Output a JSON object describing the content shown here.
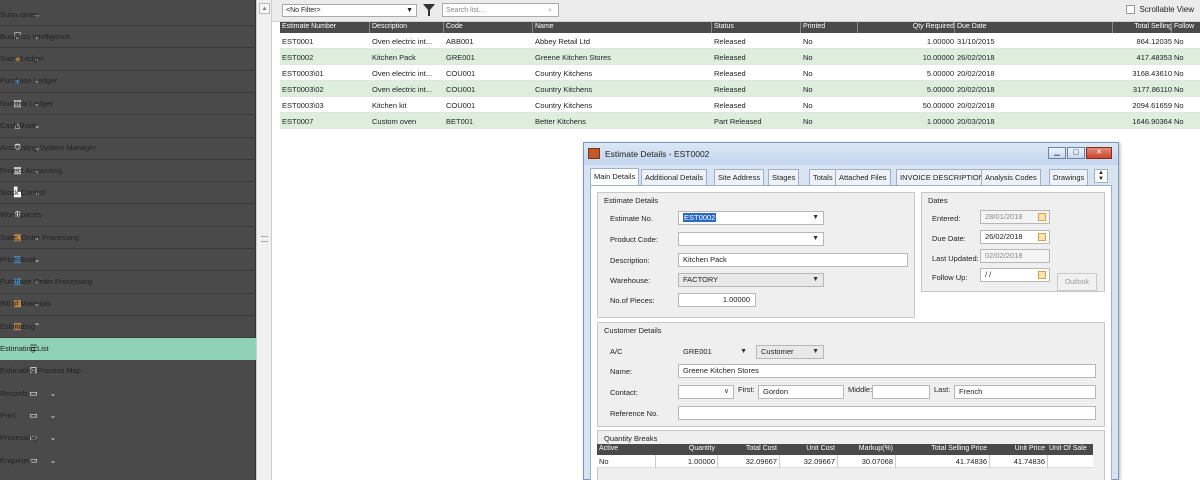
{
  "sidebar": {
    "items": [
      {
        "label": "Summaries",
        "icon": "pie-chart-icon",
        "color": "#5cb85c",
        "chevron": "down"
      },
      {
        "label": "Business Intelligence",
        "icon": "bi-icon",
        "color": "#ffffff",
        "chevron": "down"
      },
      {
        "label": "Sales Ledger",
        "icon": "person-icon",
        "color": "#f0a040",
        "chevron": "down"
      },
      {
        "label": "Purchase Ledger",
        "icon": "person-icon",
        "color": "#4aa0e0",
        "chevron": "down"
      },
      {
        "label": "Nominal Ledger",
        "icon": "book-icon",
        "color": "#ffffff",
        "chevron": "down"
      },
      {
        "label": "Cash Book",
        "icon": "bank-icon",
        "color": "#ffffff",
        "chevron": "down"
      },
      {
        "label": "Accounting System Manager",
        "icon": "settings-icon",
        "color": "#ffffff",
        "chevron": "down"
      },
      {
        "label": "Project Accounting",
        "icon": "document-icon",
        "color": "#ffffff",
        "chevron": "down"
      },
      {
        "label": "Stock Control",
        "icon": "boxes-icon",
        "color": "#ffffff",
        "chevron": "down"
      },
      {
        "label": "Workspaces",
        "icon": "globe-icon",
        "color": "#ffffff",
        "chevron": ""
      },
      {
        "label": "Sales Order Processing",
        "icon": "order-icon",
        "color": "#f0a040",
        "chevron": "down"
      },
      {
        "label": "Price Book",
        "icon": "price-book-icon",
        "color": "#4aa0e0",
        "chevron": "down"
      },
      {
        "label": "Purchase Order Processing",
        "icon": "order-icon",
        "color": "#4aa0e0",
        "chevron": "down"
      },
      {
        "label": "Bill of Materials",
        "icon": "bom-icon",
        "color": "#f0a040",
        "chevron": "down"
      },
      {
        "label": "Estimating",
        "icon": "estimating-icon",
        "color": "#f0a040",
        "chevron": "up"
      }
    ],
    "subitems": [
      {
        "label": "Estimating List",
        "icon": "list-icon",
        "active": true,
        "chevron": ""
      },
      {
        "label": "Estimating Process Map",
        "icon": "process-map-icon",
        "active": false,
        "chevron": ""
      },
      {
        "label": "Records",
        "icon": "folder-icon",
        "active": false,
        "chevron": "down"
      },
      {
        "label": "Print",
        "icon": "folder-icon",
        "active": false,
        "chevron": "down"
      },
      {
        "label": "Processing",
        "icon": "folder-icon",
        "active": false,
        "chevron": "down"
      },
      {
        "label": "Enquiries",
        "icon": "folder-icon",
        "active": false,
        "chevron": "down"
      }
    ]
  },
  "toolbar": {
    "filter_value": "<No Filter>",
    "search_placeholder": "Search list...",
    "scrollable_view_label": "Scrollable View"
  },
  "grid": {
    "headers": [
      "Estimate Number",
      "Description",
      "Code",
      "Name",
      "Status",
      "Printed",
      "Qty Required",
      "Due Date",
      "Total Selling",
      "Follow"
    ],
    "rows": [
      [
        "EST0001",
        "Oven electric int...",
        "ABB001",
        "Abbey Retail Ltd",
        "Released",
        "No",
        "1.00000",
        "31/10/2015",
        "864.12035",
        "No"
      ],
      [
        "EST0002",
        "Kitchen Pack",
        "GRE001",
        "Greene Kitchen Stores",
        "Released",
        "No",
        "10.00000",
        "26/02/2018",
        "417.48353",
        "No"
      ],
      [
        "EST0003\\01",
        "Oven electric int...",
        "COU001",
        "Country Kitchens",
        "Released",
        "No",
        "5.00000",
        "20/02/2018",
        "3168.43610",
        "No"
      ],
      [
        "EST0003\\02",
        "Oven electric int...",
        "COU001",
        "Country Kitchens",
        "Released",
        "No",
        "5.00000",
        "20/02/2018",
        "3177.86110",
        "No"
      ],
      [
        "EST0003\\03",
        "Kitchen kit",
        "COU001",
        "Country Kitchens",
        "Released",
        "No",
        "50.00000",
        "20/02/2018",
        "2094.61659",
        "No"
      ],
      [
        "EST0007",
        "Custom oven",
        "BET001",
        "Better Kitchens",
        "Part Released",
        "No",
        "1.00000",
        "20/03/2018",
        "1646.90364",
        "No"
      ]
    ]
  },
  "dialog": {
    "title": "Estimate Details - EST0002",
    "tabs": [
      "Main Details",
      "Additional Details",
      "Site Address",
      "Stages",
      "Totals",
      "Attached Files",
      "INVOICE DESCRIPTION",
      "Analysis Codes",
      "Drawings"
    ],
    "estimate_details": {
      "group_title": "Estimate Details",
      "estimate_no_label": "Estimate No.",
      "estimate_no": "EST0002",
      "product_code_label": "Product Code:",
      "product_code": "",
      "description_label": "Description:",
      "description": "Kitchen Pack",
      "warehouse_label": "Warehouse:",
      "warehouse": "FACTORY",
      "pieces_label": "No.of Pieces:",
      "pieces": "1.00000"
    },
    "dates": {
      "group_title": "Dates",
      "entered_label": "Entered:",
      "entered": "28/01/2018",
      "due_label": "Due Date:",
      "due": "26/02/2018",
      "updated_label": "Last Updated:",
      "updated": "02/02/2018",
      "follow_label": "Follow Up:",
      "follow": " / /",
      "outlook_label": "Outlook"
    },
    "customer": {
      "group_title": "Customer Details",
      "ac_label": "A/C",
      "ac": "GRE001",
      "type": "Customer",
      "name_label": "Name:",
      "name": "Greene Kitchen Stores",
      "contact_label": "Contact:",
      "contact": "",
      "first_label": "First:",
      "first": "Gordon",
      "middle_label": "Middle:",
      "middle": "",
      "last_label": "Last:",
      "last": "French",
      "ref_label": "Reference No.",
      "ref": ""
    },
    "quantity_breaks": {
      "group_title": "Quantity Breaks",
      "headers": [
        "Active",
        "Quantity",
        "Total Cost",
        "Unit Cost",
        "Markup(%)",
        "Total Selling Price",
        "Unit Price",
        "Unit Of Sale"
      ],
      "rows": [
        [
          "No",
          "1.00000",
          "32.09667",
          "32.09667",
          "30.07068",
          "41.74836",
          "41.74836",
          ""
        ]
      ]
    }
  }
}
